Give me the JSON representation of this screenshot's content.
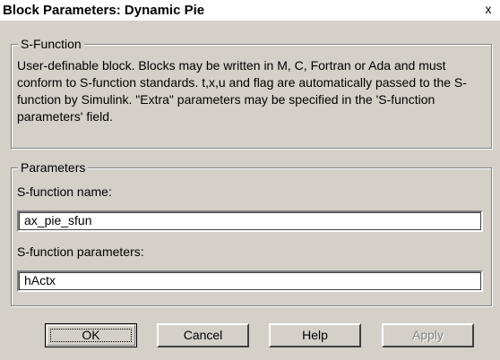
{
  "window": {
    "title": "Block Parameters: Dynamic Pie",
    "close_glyph": "x"
  },
  "sfunction_group": {
    "label": "S-Function",
    "description": "User-definable block.  Blocks may be written in M, C, Fortran or Ada and must  conform to S-function standards.  t,x,u and flag are automatically passed to the S-function by Simulink.  \"Extra\" parameters may be specified in the 'S-function parameters' field."
  },
  "parameters_group": {
    "label": "Parameters",
    "name_label": "S-function name:",
    "name_value": "ax_pie_sfun",
    "params_label": "S-function parameters:",
    "params_value": "hActx"
  },
  "buttons": {
    "ok": "OK",
    "cancel": "Cancel",
    "help": "Help",
    "apply": "Apply"
  }
}
